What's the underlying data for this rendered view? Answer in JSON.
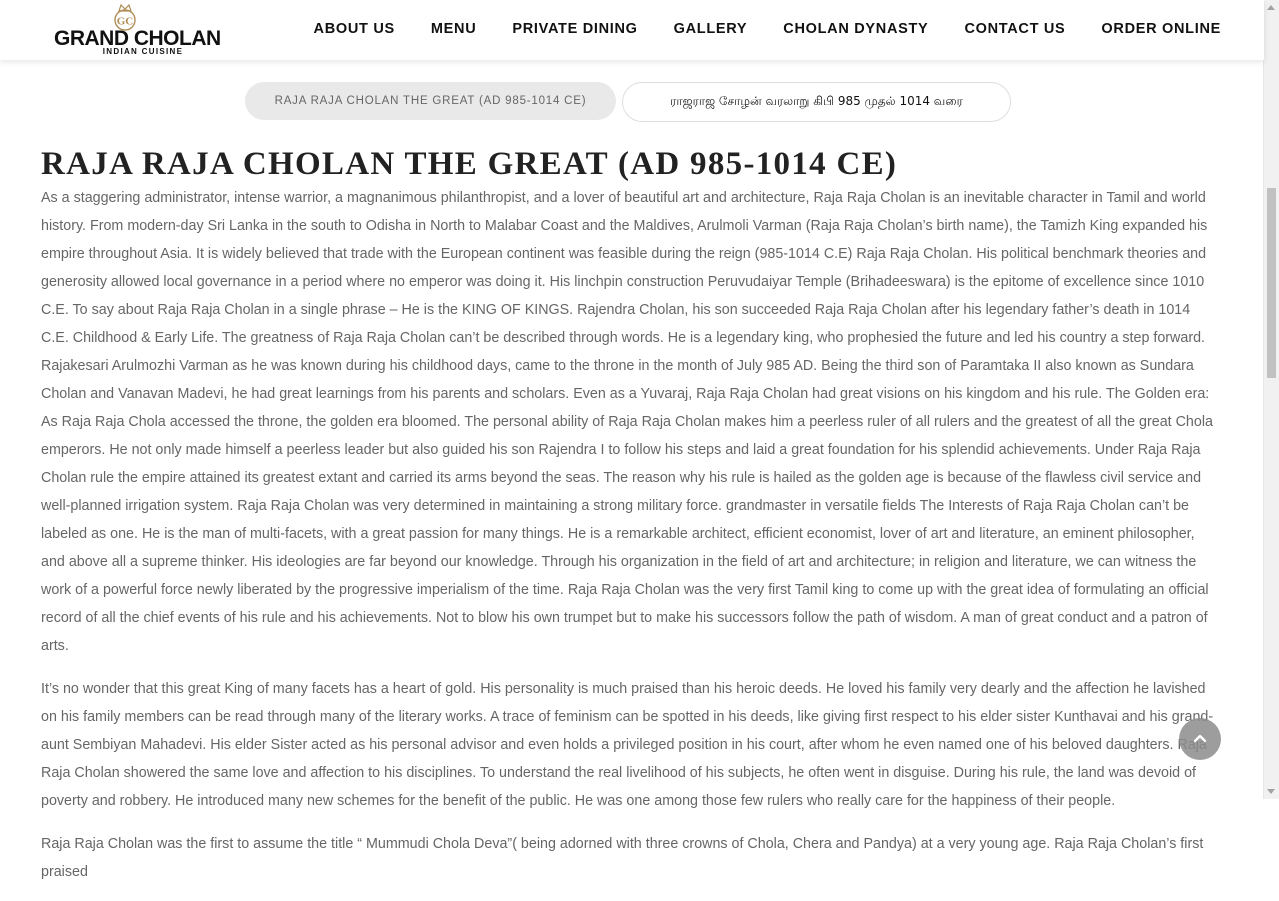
{
  "logo": {
    "name": "GRAND CHOLAN",
    "tagline": "INDIAN CUISINE",
    "emblem": "gc-monogram-icon",
    "accent": "#b08d57"
  },
  "nav": {
    "items": [
      {
        "label": "ABOUT US"
      },
      {
        "label": "MENU"
      },
      {
        "label": "PRIVATE DINING"
      },
      {
        "label": "GALLERY"
      },
      {
        "label": "CHOLAN DYNASTY"
      },
      {
        "label": "CONTACT US"
      },
      {
        "label": "ORDER ONLINE"
      }
    ]
  },
  "tabs": [
    {
      "label": "RAJA RAJA CHOLAN THE GREAT (AD 985-1014 CE)",
      "active": true
    },
    {
      "label": "ராஜராஜ சோழன் வரலாறு கிபி 985 முதல் 1014 வரை",
      "active": false
    }
  ],
  "article": {
    "title": "RAJA RAJA CHOLAN THE GREAT (AD 985-1014 CE)",
    "paragraphs": [
      "As a staggering administrator, intense warrior, a magnanimous philanthropist, and a lover of beautiful art and architecture, Raja Raja Cholan is an inevitable character in Tamil and world history. From modern-day Sri Lanka in the south to Odisha in North to Malabar Coast and the Maldives, Arulmoli Varman (Raja Raja Cholan’s birth name), the Tamizh King expanded his empire throughout Asia. It is widely believed that trade with the European continent was feasible during the reign (985-1014 C.E) Raja Raja Cholan.  His political benchmark theories and generosity allowed local governance in a period where no emperor was doing it. His linchpin construction Peruvudaiyar Temple (Brihadeeswara) is the epitome of excellence since 1010 C.E. To say about Raja Raja Cholan in a single phrase – He is the KING OF KINGS. Rajendra Cholan, his son succeeded Raja Raja Cholan after his legendary father’s death in 1014 C.E.  Childhood & Early Life. The greatness of Raja Raja Cholan can’t be described through words. He is a legendary king, who prophesied the future and led his country a step forward. Rajakesari Arulmozhi Varman as he was known during his childhood days, came to the throne in the month of July 985 AD. Being the third son of Paramtaka II also known as Sundara Cholan and Vanavan Madevi, he had great learnings from his parents and scholars. Even as a Yuvaraj, Raja Raja Cholan had great visions on his kingdom and his rule. The Golden era:  As Raja Raja Chola accessed the throne, the golden era bloomed. The personal ability of Raja Raja Cholan makes him a peerless ruler of all rulers and the greatest of all the great Chola emperors. He not only made himself a peerless leader but also guided his son Rajendra I to follow his steps and laid a great foundation for his splendid achievements. Under Raja Raja Cholan rule the empire attained its greatest extant and carried its arms beyond the seas. The reason why his rule is hailed as the golden age is because of the flawless civil service and well-planned irrigation system. Raja Raja Cholan was very determined in maintaining a strong military force.  grandmaster in versatile fields The Interests of Raja Raja Cholan can’t be labeled as one. He is the man of multi-facets, with a great passion for many things. He is a remarkable architect, efficient economist, lover of art and literature, an eminent philosopher, and above all a supreme thinker. His ideologies are far beyond our knowledge. Through his organization in the field of art and architecture; in religion and literature, we can witness the work of a powerful force newly liberated by the progressive imperialism of the time.  Raja Raja Cholan was the very first Tamil king to come up with the great idea of formulating an official record of all the chief events of his rule and his achievements. Not to blow his own trumpet but to make his successors follow the path of wisdom.  A man of great conduct and a patron of arts.",
      "It’s no wonder that this great King of many facets has a heart of gold. His personality is much praised than his heroic deeds. He loved his family very dearly and the affection he lavished on his family members can be read through many of the literary works.  A trace of feminism can be spotted in his deeds, like giving first respect to his elder sister Kunthavai and his grand-aunt Sembiyan Mahadevi. His elder Sister acted as his personal advisor and even holds a privileged position in his court, after whom he even named one of his beloved daughters.  Raja Raja Cholan showered the same love and affection to his disciplines. To understand the real livelihood of his subjects, he often went in disguise. During his rule, the land was devoid of poverty and robbery. He introduced many new schemes for the benefit of the public. He was one among those few rulers who really care for the happiness of their people.",
      "Raja Raja Cholan was the first to assume the title “ Mummudi Chola Deva”( being adorned with three crowns of Chola, Chera and Pandya) at a very young age. Raja Raja Cholan’s first praised"
    ]
  },
  "back_to_top": {
    "icon": "chevron-up-icon"
  },
  "colors": {
    "text": "#666666",
    "heading": "#222222",
    "nav_text": "#111111",
    "tab_active_bg": "#e9e9e9"
  }
}
